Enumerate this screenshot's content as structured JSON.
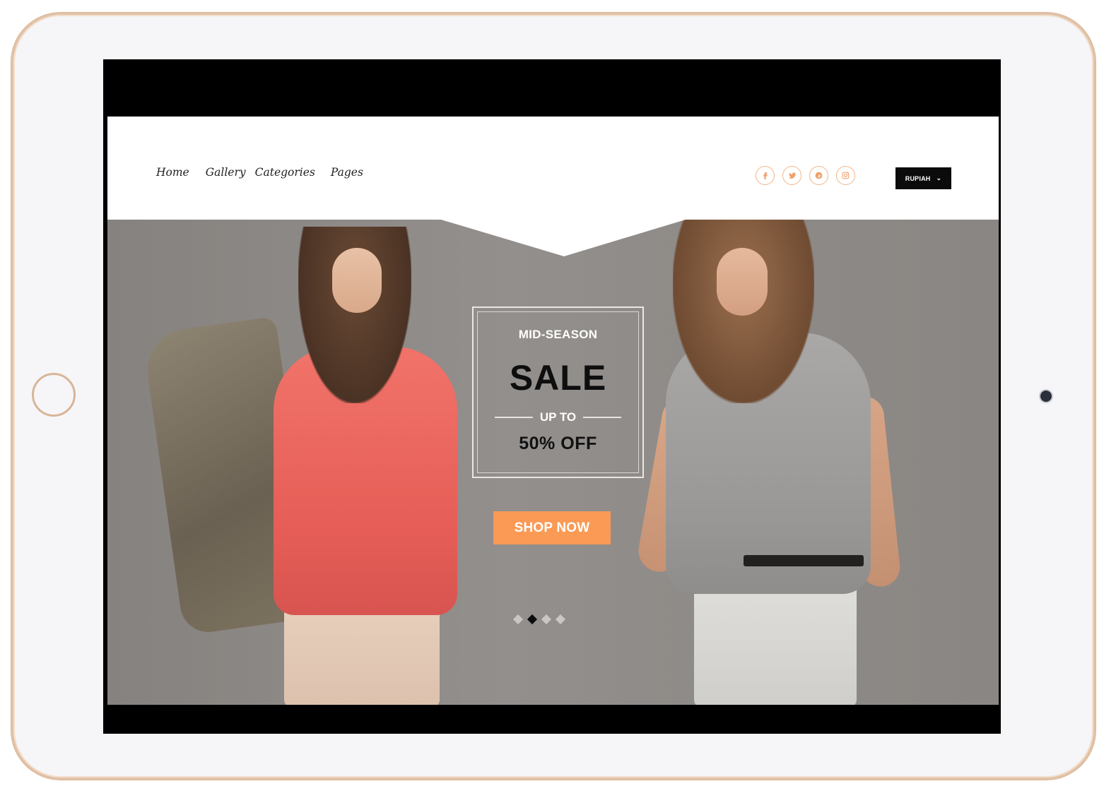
{
  "nav": {
    "items": [
      {
        "label": "Home"
      },
      {
        "label": "Gallery"
      },
      {
        "label": "Categories"
      },
      {
        "label": "Pages"
      }
    ]
  },
  "social": {
    "icons": [
      "facebook-icon",
      "twitter-icon",
      "pinterest-icon",
      "instagram-icon"
    ],
    "accent_color": "#f0a06a"
  },
  "currency": {
    "selected": "RUPIAH"
  },
  "hero": {
    "promo": {
      "eyebrow": "MID-SEASON",
      "headline": "SALE",
      "up_to": "UP TO",
      "discount": "50%",
      "off": "OFF"
    },
    "cta_label": "SHOP NOW",
    "cta_color": "#fb9a55",
    "slider": {
      "count": 4,
      "active_index": 1
    }
  }
}
